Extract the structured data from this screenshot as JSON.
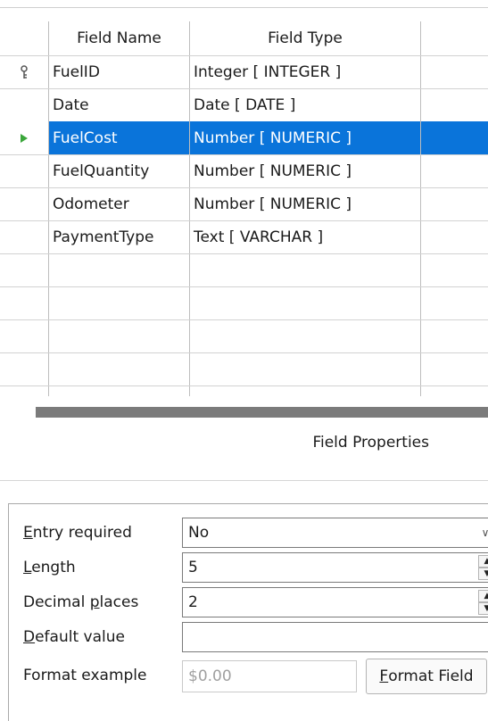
{
  "table": {
    "headers": [
      "Field Name",
      "Field Type"
    ],
    "rows": [
      {
        "name": "FuelID",
        "type": "Integer [ INTEGER ]",
        "marker": "key-icon"
      },
      {
        "name": "Date",
        "type": "Date [ DATE ]",
        "marker": ""
      },
      {
        "name": "FuelCost",
        "type": "Number [ NUMERIC ]",
        "marker": "current-row-arrow-icon",
        "selected": true
      },
      {
        "name": "FuelQuantity",
        "type": "Number [ NUMERIC ]",
        "marker": ""
      },
      {
        "name": "Odometer",
        "type": "Number [ NUMERIC ]",
        "marker": ""
      },
      {
        "name": "PaymentType",
        "type": "Text [ VARCHAR ]",
        "marker": ""
      }
    ],
    "empty_rows": 4
  },
  "field_properties": {
    "title": "Field Properties",
    "entry_required": {
      "label_prefix": "",
      "mnemonic": "E",
      "label_rest": "ntry required",
      "value": "No"
    },
    "length": {
      "mnemonic": "L",
      "label_rest": "ength",
      "value": "5"
    },
    "decimal_places": {
      "label_prefix": "Decimal ",
      "mnemonic": "p",
      "label_rest": "laces",
      "value": "2"
    },
    "default_value": {
      "mnemonic": "D",
      "label_rest": "efault value",
      "value": ""
    },
    "format_example": {
      "label": "Format example",
      "value": "$0.00"
    },
    "format_button": {
      "mnemonic": "F",
      "label_rest": "ormat Field"
    }
  },
  "colors": {
    "selection": "#0a74da",
    "key_icon": "#555555",
    "arrow_icon": "#3aa63a"
  }
}
